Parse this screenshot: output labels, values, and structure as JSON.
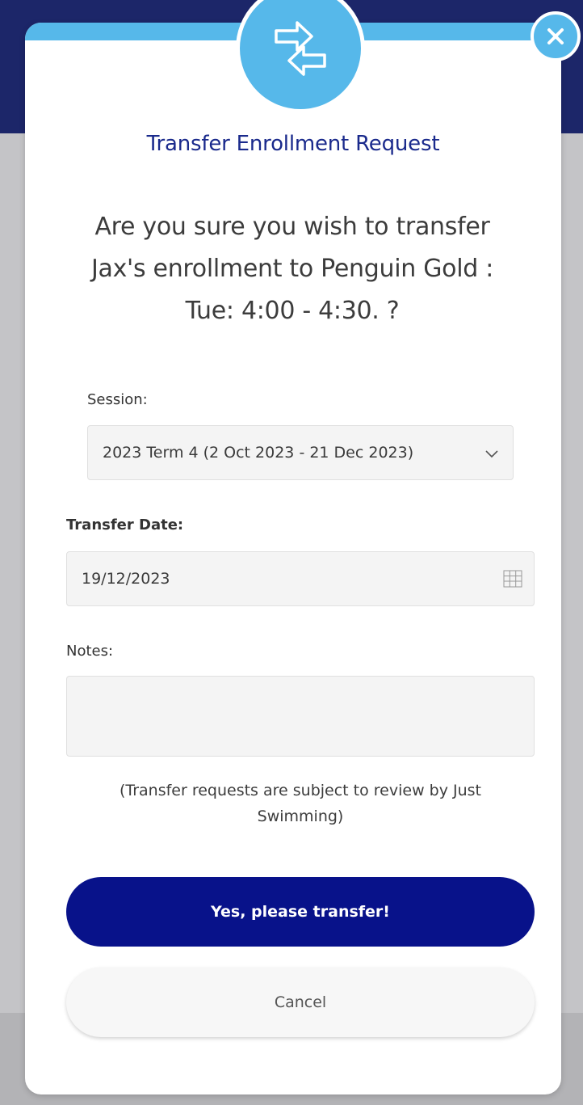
{
  "dialog": {
    "title": "Transfer Enrollment Request",
    "question": "Are you sure you wish to transfer Jax's enrollment to Penguin Gold : Tue: 4:00 - 4:30. ?",
    "icon": "transfer-arrows-icon",
    "close_icon": "close-icon"
  },
  "session": {
    "label": "Session:",
    "value": "2023 Term 4 (2 Oct 2023 - 21 Dec 2023)"
  },
  "transfer_date": {
    "label": "Transfer Date:",
    "value": "19/12/2023"
  },
  "notes": {
    "label": "Notes:",
    "value": ""
  },
  "review_note": "(Transfer requests are subject to review by Just Swimming)",
  "buttons": {
    "confirm": "Yes, please transfer!",
    "cancel": "Cancel"
  },
  "colors": {
    "accent": "#56b8ea",
    "primary": "#08128a",
    "title": "#1a2a8c"
  }
}
